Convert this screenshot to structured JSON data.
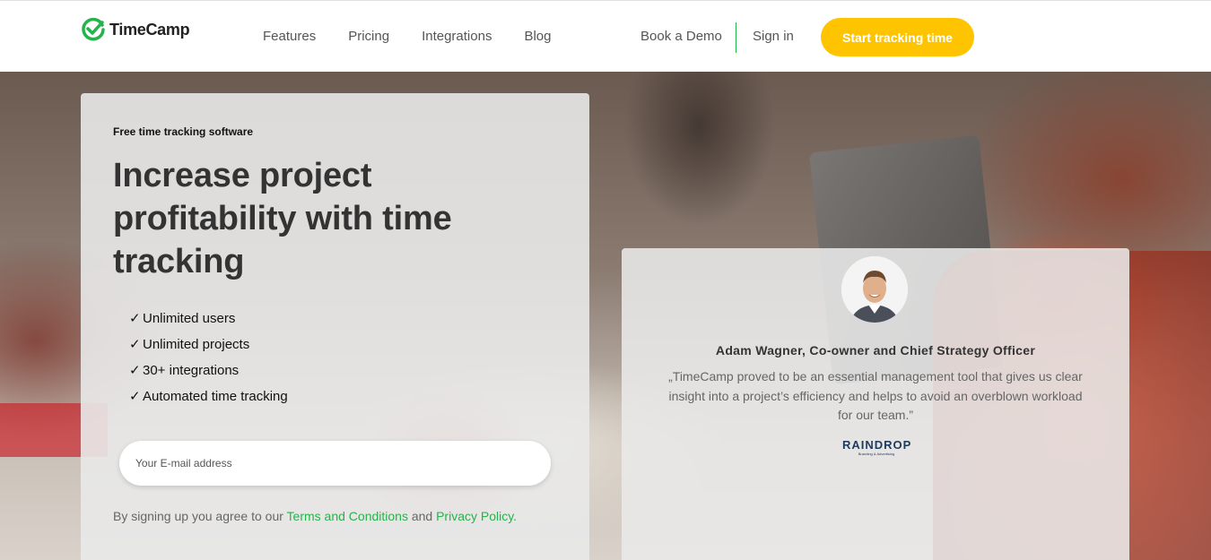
{
  "header": {
    "logo_text": "TimeCamp",
    "nav": [
      "Features",
      "Pricing",
      "Integrations",
      "Blog"
    ],
    "book_demo": "Book a Demo",
    "sign_in": "Sign in",
    "cta": "Start tracking time"
  },
  "hero": {
    "eyebrow": "Free time tracking software",
    "headline": "Increase project profitability with time tracking",
    "checklist": [
      "Unlimited users",
      "Unlimited projects",
      "30+ integrations",
      "Automated time tracking"
    ],
    "email_placeholder": "Your E-mail address",
    "legal_prefix": "By signing up you agree to our",
    "terms": "Terms and Conditions",
    "and": "and",
    "privacy": "Privacy Policy."
  },
  "testimonial": {
    "name": "Adam Wagner, Co-owner and Chief Strategy Officer",
    "quote": "„TimeCamp proved to be an essential management tool that gives us clear insight into a project’s efficiency and helps to avoid an overblown workload for our team.”",
    "company_logo": "RAINDROP",
    "company_tagline": "Branding & Advertising"
  },
  "colors": {
    "brand_green": "#25b34b",
    "cta_yellow": "#ffc400"
  },
  "icons": {
    "logo": "timecamp-check-logo-icon",
    "check": "checkmark-icon"
  }
}
